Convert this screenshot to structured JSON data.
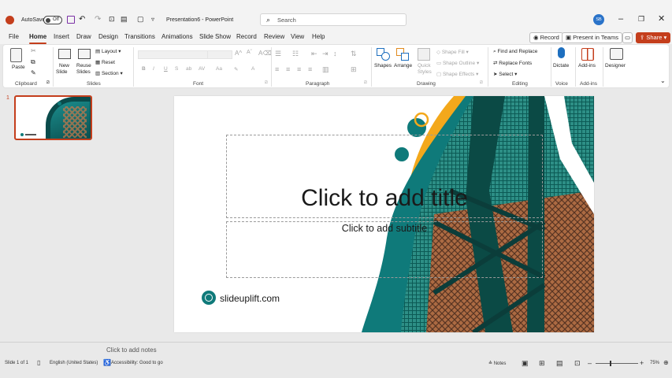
{
  "titlebar": {
    "autosave_label": "AutoSave",
    "autosave_state": "Off",
    "doc_title": "Presentation6 - PowerPoint",
    "search_placeholder": "Search",
    "avatar_initials": "SB"
  },
  "tabs": {
    "items": [
      "File",
      "Home",
      "Insert",
      "Draw",
      "Design",
      "Transitions",
      "Animations",
      "Slide Show",
      "Record",
      "Review",
      "View",
      "Help"
    ],
    "active": "Home"
  },
  "tab_buttons": {
    "record": "Record",
    "present_teams": "Present in Teams",
    "share": "Share"
  },
  "ribbon": {
    "clipboard": {
      "paste": "Paste",
      "label": "Clipboard"
    },
    "slides": {
      "new_slide": "New",
      "new_slide2": "Slide",
      "reuse": "Reuse",
      "reuse2": "Slides",
      "layout": "Layout",
      "reset": "Reset",
      "section": "Section",
      "label": "Slides"
    },
    "font": {
      "label": "Font"
    },
    "paragraph": {
      "label": "Paragraph"
    },
    "drawing": {
      "shapes": "Shapes",
      "arrange": "Arrange",
      "quick_styles": "Quick",
      "quick_styles2": "Styles",
      "shape_fill": "Shape Fill",
      "shape_outline": "Shape Outline",
      "shape_effects": "Shape Effects",
      "label": "Drawing"
    },
    "editing": {
      "find_replace": "Find and Replace",
      "replace_fonts": "Replace Fonts",
      "select": "Select",
      "label": "Editing"
    },
    "voice": {
      "dictate": "Dictate",
      "label": "Voice"
    },
    "addins": {
      "addins": "Add-ins",
      "label": "Add-ins"
    },
    "designer": {
      "designer": "Designer"
    }
  },
  "thumbnail": {
    "number": "1"
  },
  "slide": {
    "title_placeholder": "Click to add title",
    "subtitle_placeholder": "Click to add subtitle",
    "brand": "slideuplift.com",
    "colors": {
      "teal": "#0f7a7a",
      "orange": "#f3a81b",
      "dark_teal": "#0a4b4b"
    }
  },
  "notes": {
    "placeholder": "Click to add notes"
  },
  "status": {
    "slide_of": "Slide 1 of 1",
    "language": "English (United States)",
    "accessibility": "Accessibility: Good to go",
    "notes": "Notes",
    "zoom": "75%"
  },
  "colors": {
    "accent": "#c43e1c",
    "avatar": "#2a73c9"
  }
}
